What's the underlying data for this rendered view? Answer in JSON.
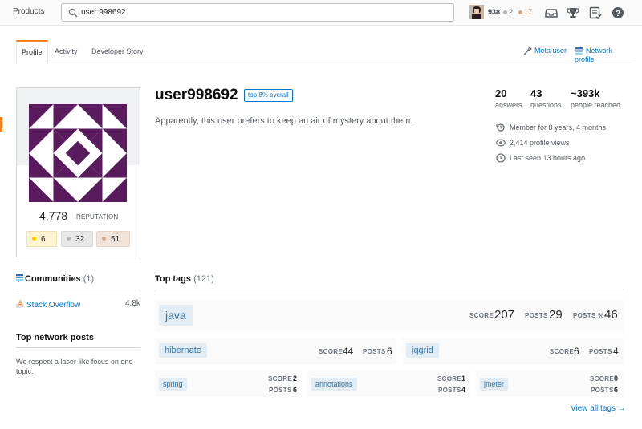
{
  "topbar": {
    "products_label": "Products",
    "search_value": "user:998692",
    "reputation": "938",
    "silver_count": "2",
    "bronze_count": "17",
    "icons": [
      "inbox-icon",
      "achievements-icon",
      "review-icon",
      "help-icon"
    ]
  },
  "tabs": {
    "items": [
      "Profile",
      "Activity",
      "Developer Story"
    ],
    "meta_user": "Meta user",
    "network_profile": "Network profile"
  },
  "card": {
    "reputation": "4,778",
    "reputation_label": "REPUTATION",
    "gold": "6",
    "silver": "32",
    "bronze": "51"
  },
  "user": {
    "name": "user998692",
    "top_badge": "top 8% overall",
    "about": "Apparently, this user prefers to keep an air of mystery about them."
  },
  "stats": {
    "answers": "20",
    "answers_label": "answers",
    "questions": "43",
    "questions_label": "questions",
    "people": "~393k",
    "people_label": "people reached",
    "member_for": "Member for 8 years, 4 months",
    "profile_views": "2,414 profile views",
    "last_seen": "Last seen 13 hours ago"
  },
  "communities": {
    "title": "Communities",
    "count": "(1)",
    "site": "Stack Overflow",
    "site_rep": "4.8k"
  },
  "network_posts": {
    "title": "Top network posts",
    "text": "We respect a laser-like focus on one topic."
  },
  "top_tags": {
    "title": "Top tags",
    "count": "(121)",
    "score_label": "SCORE",
    "posts_label": "POSTS",
    "posts_pct_label": "POSTS %",
    "java": {
      "name": "java",
      "score": "207",
      "posts": "29",
      "posts_pct": "46"
    },
    "hibernate": {
      "name": "hibernate",
      "score": "44",
      "posts": "6"
    },
    "jqgrid": {
      "name": "jqgrid",
      "score": "6",
      "posts": "4"
    },
    "spring": {
      "name": "spring",
      "score": "2",
      "posts": "6"
    },
    "annotations": {
      "name": "annotations",
      "score": "1",
      "posts": "4"
    },
    "jmeter": {
      "name": "jmeter",
      "score": "0",
      "posts": "6"
    },
    "view_all": "View all tags →"
  },
  "colors": {
    "accent": "#f48024",
    "link": "#0077cc",
    "identicon": "#5a1a5e",
    "gold": "#ffcc01",
    "silver": "#b4b8bc",
    "bronze": "#d1a684"
  }
}
